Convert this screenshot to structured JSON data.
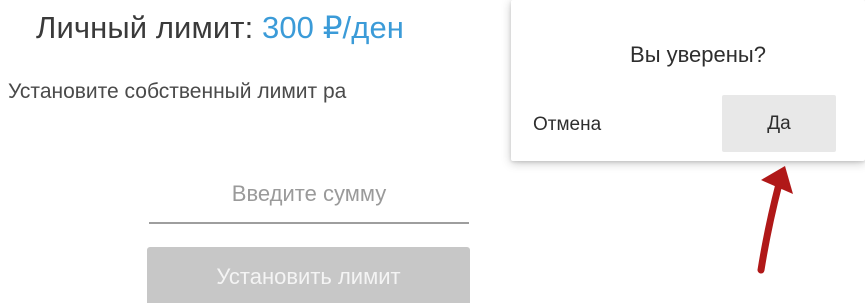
{
  "limit": {
    "title_label": "Личный лимит: ",
    "title_value": "300 ₽/ден",
    "description": "Установите собственный лимит ра",
    "amount_placeholder": "Введите сумму",
    "amount_value": "",
    "set_button_label": "Установить лимит"
  },
  "dialog": {
    "question": "Вы уверены?",
    "cancel_label": "Отмена",
    "confirm_label": "Да"
  },
  "annotation": {
    "arrow_icon": "red-arrow-pointing-up",
    "arrow_color": "#b01818"
  },
  "colors": {
    "accent": "#3b9bd8",
    "disabled_button": "#c7c7c7"
  }
}
